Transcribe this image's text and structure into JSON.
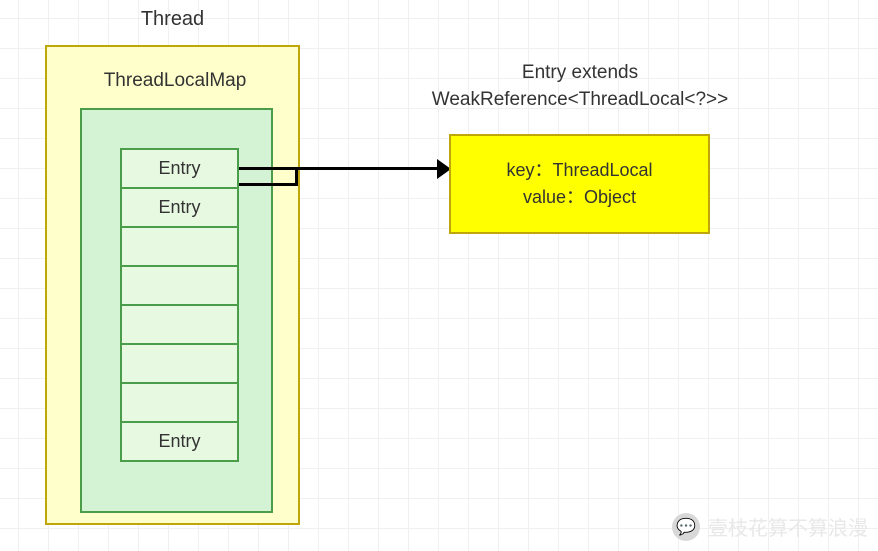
{
  "thread": {
    "title": "Thread",
    "map": {
      "title": "ThreadLocalMap",
      "entries": [
        {
          "label": "Entry"
        },
        {
          "label": "Entry"
        },
        {
          "label": ""
        },
        {
          "label": ""
        },
        {
          "label": ""
        },
        {
          "label": ""
        },
        {
          "label": ""
        },
        {
          "label": "Entry"
        }
      ]
    }
  },
  "entry_detail": {
    "extends_label": "Entry extends\nWeakReference<ThreadLocal<?>>",
    "key_line": "key：ThreadLocal",
    "value_line": "value：Object"
  },
  "watermark": {
    "text": "壹枝花算不算浪漫",
    "icon_glyph": "💬"
  }
}
